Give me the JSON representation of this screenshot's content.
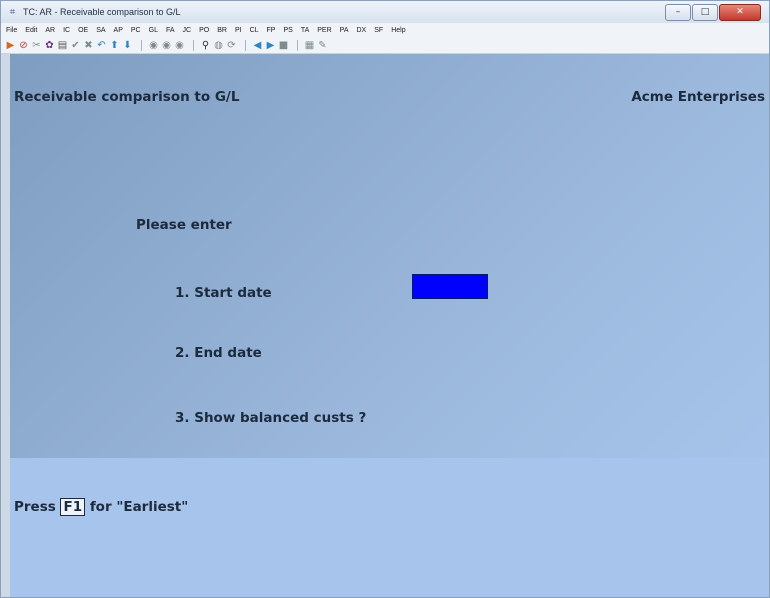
{
  "window": {
    "title": "TC: AR - Receivable comparison to G/L",
    "controls": {
      "minimize": "–",
      "maximize": "□",
      "close": "✕"
    }
  },
  "menu": [
    "File",
    "Edit",
    "AR",
    "IC",
    "OE",
    "SA",
    "AP",
    "PC",
    "GL",
    "FA",
    "JC",
    "PO",
    "BR",
    "PI",
    "CL",
    "FP",
    "PS",
    "TA",
    "PER",
    "PA",
    "DX",
    "SF",
    "Help"
  ],
  "toolbar": {
    "groups": [
      [
        {
          "icon": "run-icon",
          "glyph": "▶",
          "color": "#d2691e"
        },
        {
          "icon": "stop-icon",
          "glyph": "⊘",
          "color": "#c0392b"
        },
        {
          "icon": "cut-icon",
          "glyph": "✂",
          "color": "#7f8c8d"
        },
        {
          "icon": "settings-icon",
          "glyph": "✿",
          "color": "#6c3483"
        },
        {
          "icon": "print-icon",
          "glyph": "▤",
          "color": "#555555"
        },
        {
          "icon": "check-icon",
          "glyph": "✔",
          "color": "#7f8c8d"
        },
        {
          "icon": "delete-icon",
          "glyph": "✖",
          "color": "#7f8c8d"
        },
        {
          "icon": "undo-icon",
          "glyph": "↶",
          "color": "#2e86c1"
        },
        {
          "icon": "up-arrow-icon",
          "glyph": "⬆",
          "color": "#2e86c1"
        },
        {
          "icon": "down-arrow-icon",
          "glyph": "⬇",
          "color": "#2e86c1"
        }
      ],
      [
        {
          "icon": "record-1-icon",
          "glyph": "◉",
          "color": "#7f8c8d"
        },
        {
          "icon": "record-2-icon",
          "glyph": "◉",
          "color": "#7f8c8d"
        },
        {
          "icon": "record-3-icon",
          "glyph": "◉",
          "color": "#7f8c8d"
        }
      ],
      [
        {
          "icon": "find-icon",
          "glyph": "⚲",
          "color": "#333333"
        },
        {
          "icon": "zoom-icon",
          "glyph": "◍",
          "color": "#7f8c8d"
        },
        {
          "icon": "refresh-icon",
          "glyph": "⟳",
          "color": "#7f8c8d"
        }
      ],
      [
        {
          "icon": "previous-icon",
          "glyph": "◀",
          "color": "#2e86c1"
        },
        {
          "icon": "next-icon",
          "glyph": "▶",
          "color": "#2e86c1"
        },
        {
          "icon": "stop-record-icon",
          "glyph": "■",
          "color": "#7f8c8d"
        }
      ],
      [
        {
          "icon": "calculator-icon",
          "glyph": "▦",
          "color": "#7f8c8d"
        },
        {
          "icon": "notes-icon",
          "glyph": "✎",
          "color": "#7f8c8d"
        }
      ]
    ]
  },
  "screen": {
    "heading": "Receivable comparison to G/L",
    "company": "Acme Enterprises",
    "prompt": "Please enter",
    "fields": [
      {
        "label": "1. Start date"
      },
      {
        "label": "2. End date"
      },
      {
        "label": "3. Show balanced custs ?"
      }
    ],
    "message": {
      "prefix": "Press",
      "key": "F1",
      "suffix": "for \"Earliest\""
    }
  },
  "colors": {
    "active_field": "#0000ff",
    "text": "#1c2a3d"
  }
}
